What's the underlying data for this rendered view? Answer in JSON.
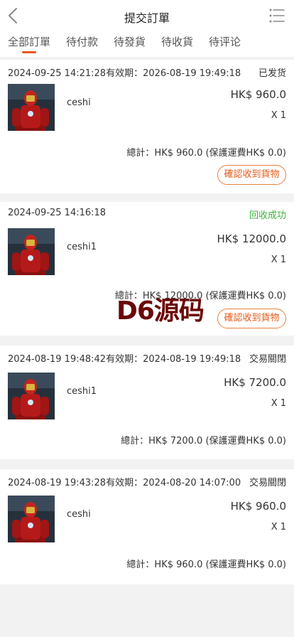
{
  "header": {
    "title": "提交訂單",
    "back_icon": "chevron-left-icon",
    "menu_icon": "list-menu-icon"
  },
  "tabs": [
    {
      "label": "全部訂單",
      "active": true
    },
    {
      "label": "待付款",
      "active": false
    },
    {
      "label": "待發貨",
      "active": false
    },
    {
      "label": "待收貨",
      "active": false
    },
    {
      "label": "待评论",
      "active": false
    }
  ],
  "orders": [
    {
      "date": "2024-09-25 14:21:28有效期：2026-08-19 19:49:18",
      "status": "已发货",
      "item_name": "ceshi",
      "price": "HK$ 960.0",
      "qty": "X 1",
      "total": "總計：HK$ 960.0 (保護運費HK$ 0.0)",
      "action": "確認收到貨物"
    },
    {
      "date": "2024-09-25 14:16:18",
      "status": "回收成功",
      "item_name": "ceshi1",
      "price": "HK$ 12000.0",
      "qty": "X 1",
      "total": "總計：HK$ 12000.0 (保護運費HK$ 0.0)",
      "action": "確認收到貨物"
    },
    {
      "date": "2024-08-19 19:48:42有效期：2024-08-19 19:49:18",
      "status": "交易關閉",
      "item_name": "ceshi1",
      "price": "HK$ 7200.0",
      "qty": "X 1",
      "total": "總計：HK$ 7200.0 (保護運費HK$ 0.0)"
    },
    {
      "date": "2024-08-19 19:43:28有效期：2024-08-20 14:07:00",
      "status": "交易關閉",
      "item_name": "ceshi",
      "price": "HK$ 960.0",
      "qty": "X 1",
      "total": "總計：HK$ 960.0 (保護運費HK$ 0.0)"
    }
  ],
  "watermark": "D6源码",
  "colors": {
    "accent": "#e8591a",
    "success": "#3fb33f",
    "watermark": "#6b0606"
  }
}
